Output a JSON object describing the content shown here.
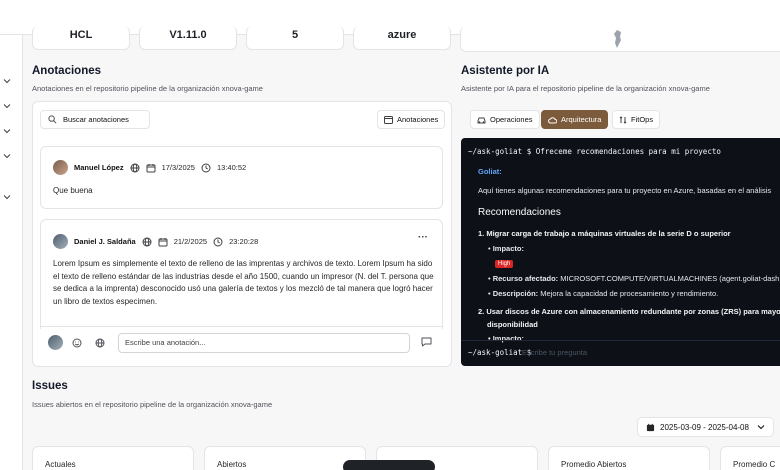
{
  "top_stats": [
    "HCL",
    "V1.11.0",
    "5",
    "azure"
  ],
  "annotations": {
    "title": "Anotaciones",
    "subtitle": "Anotaciones en el repositorio pipeline de la organización xnova-game",
    "search_placeholder": "Buscar anotaciones",
    "button_label": "Anotaciones",
    "comments": [
      {
        "author": "Manuel López",
        "date": "17/3/2025",
        "time": "13:40:52",
        "body": "Que buena"
      },
      {
        "author": "Daniel J. Saldaña",
        "date": "21/2/2025",
        "time": "23:20:28",
        "more": "···",
        "body": "Lorem Ipsum es simplemente el texto de relleno de las imprentas y archivos de texto. Lorem Ipsum ha sido el texto de relleno estándar de las industrias desde el año 1500, cuando un impresor (N. del T. persona que se dedica a la imprenta) desconocido usó una galería de textos y los mezcló de tal manera que logró hacer un libro de textos especimen."
      }
    ],
    "composer_placeholder": "Escribe una anotación..."
  },
  "assistant": {
    "title": "Asistente por IA",
    "subtitle": "Asistente por IA para el repositorio pipeline de la organización xnova-game",
    "tabs": [
      {
        "label": "Operaciones",
        "active": false
      },
      {
        "label": "Arquitectura",
        "active": true
      },
      {
        "label": "FitOps",
        "active": false
      }
    ],
    "terminal": {
      "command": "~/ask-goliat $ Ofreceme recomendaciones para mi proyecto",
      "speaker": "Goliat:",
      "intro": "Aquí tienes algunas recomendaciones para tu proyecto en Azure, basadas en el análisis",
      "heading": "Recomendaciones",
      "item1_title": "1. Migrar carga de trabajo a máquinas virtuales de la serie D o superior",
      "impact_label": "Impacto:",
      "impact_value": "High",
      "resource_label": "Recurso afectado:",
      "resource_value": "MICROSOFT.COMPUTE/VIRTUALMACHINES (agent.goliat-dash",
      "desc_label": "Descripción:",
      "desc_value": "Mejora la capacidad de procesamiento y rendimiento.",
      "item2_title_a": "2. Usar discos de Azure con almacenamiento redundante por zonas (ZRS) para mayo",
      "item2_title_b": "disponibilidad",
      "item2_impact_partial": "Impacto:",
      "prompt": "~/ask-goliat $",
      "prompt_placeholder": "Escribe tu pregunta"
    }
  },
  "issues": {
    "title": "Issues",
    "subtitle": "Issues abiertos en el repositorio pipeline de la organización xnova-game",
    "date_range": "2025-03-09 - 2025-04-08",
    "cards": [
      "Actuales",
      "Abiertos",
      "",
      "Promedio Abiertos",
      "Promedio C"
    ]
  },
  "colors": {
    "accent_brown": "#7c5a3c",
    "terminal_bg": "#0d1117",
    "high_badge": "#dc2626",
    "goliat_label": "#60a5fa"
  }
}
